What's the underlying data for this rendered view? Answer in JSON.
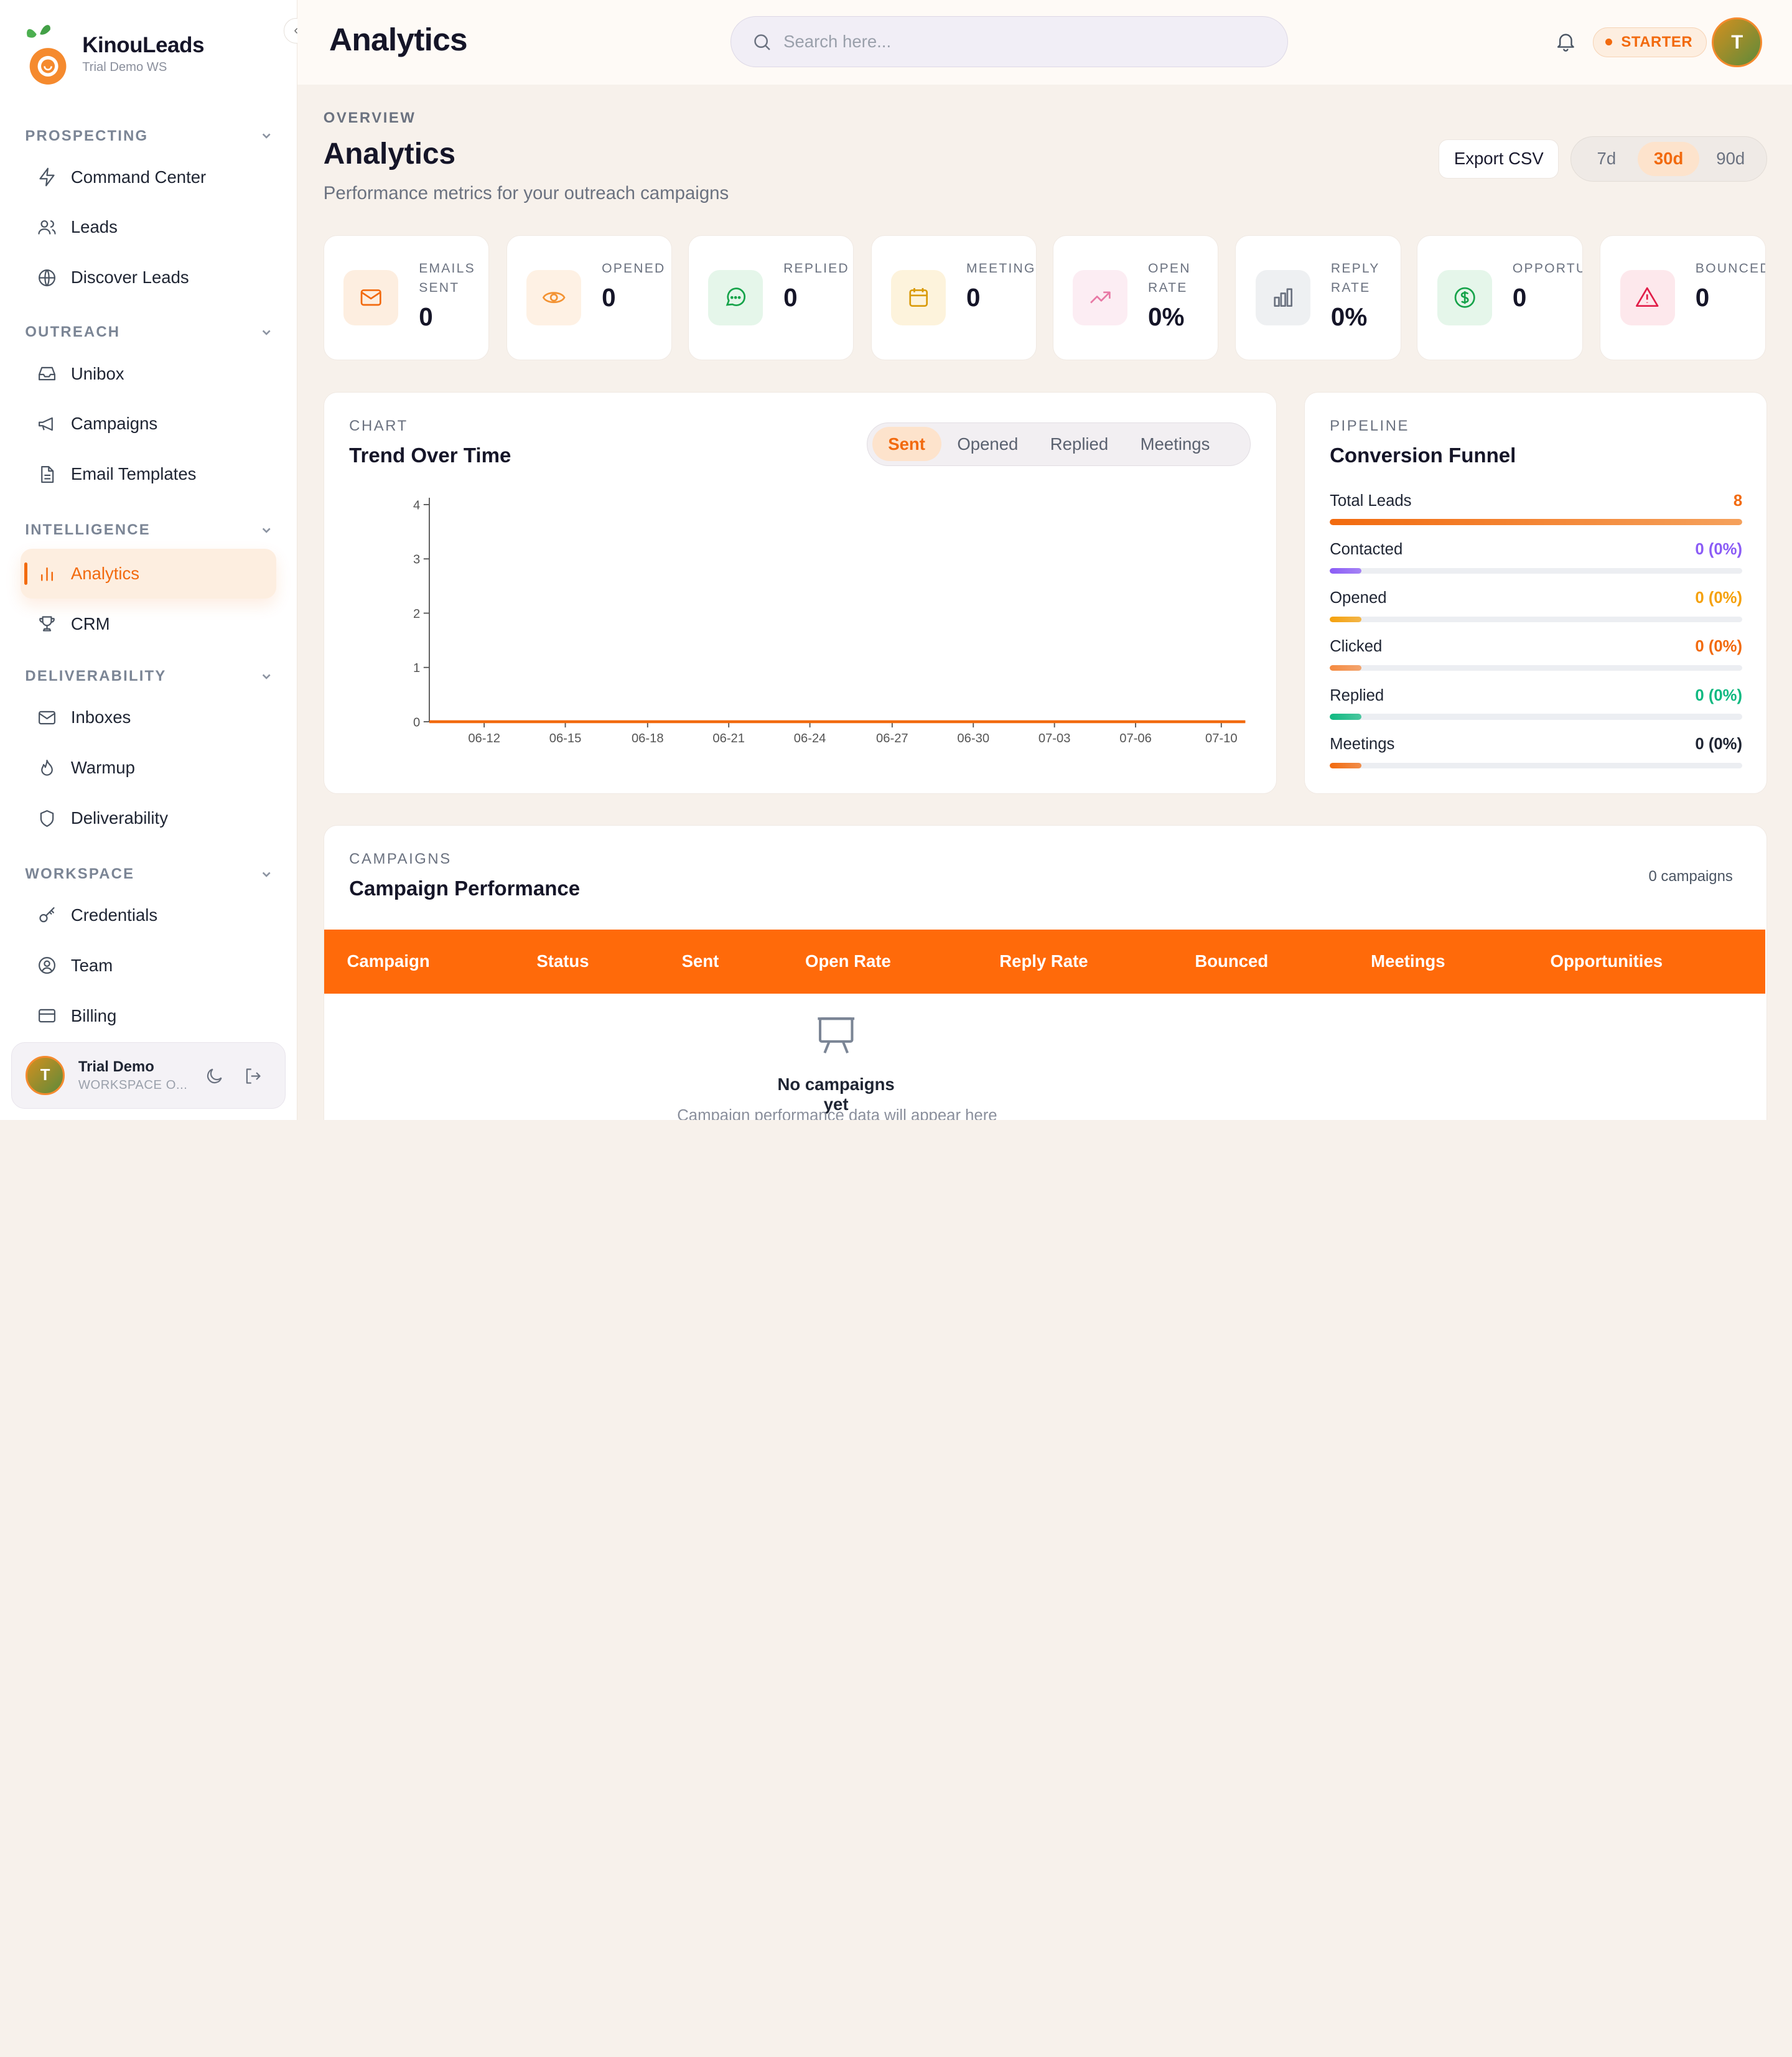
{
  "brand": {
    "name": "KinouLeads",
    "workspace": "Trial Demo WS"
  },
  "topbar": {
    "title": "Analytics",
    "search_placeholder": "Search here...",
    "plan": "STARTER",
    "avatar_initial": "T"
  },
  "sidebar": {
    "sections": [
      {
        "title": "PROSPECTING",
        "items": [
          {
            "label": "Command Center",
            "icon": "zap-icon"
          },
          {
            "label": "Leads",
            "icon": "users-icon"
          },
          {
            "label": "Discover Leads",
            "icon": "globe-icon"
          }
        ]
      },
      {
        "title": "OUTREACH",
        "items": [
          {
            "label": "Unibox",
            "icon": "inbox-icon"
          },
          {
            "label": "Campaigns",
            "icon": "megaphone-icon"
          },
          {
            "label": "Email Templates",
            "icon": "file-text-icon"
          }
        ]
      },
      {
        "title": "INTELLIGENCE",
        "items": [
          {
            "label": "Analytics",
            "icon": "bar-chart-icon",
            "active": true
          },
          {
            "label": "CRM",
            "icon": "trophy-icon"
          }
        ]
      },
      {
        "title": "DELIVERABILITY",
        "items": [
          {
            "label": "Inboxes",
            "icon": "mail-icon"
          },
          {
            "label": "Warmup",
            "icon": "flame-icon"
          },
          {
            "label": "Deliverability",
            "icon": "shield-icon"
          }
        ]
      },
      {
        "title": "WORKSPACE",
        "items": [
          {
            "label": "Credentials",
            "icon": "key-icon"
          },
          {
            "label": "Team",
            "icon": "user-circle-icon"
          },
          {
            "label": "Billing",
            "icon": "credit-card-icon"
          }
        ]
      }
    ],
    "user": {
      "name": "Trial Demo",
      "workspace": "WORKSPACE O...",
      "initial": "T"
    }
  },
  "header": {
    "overline": "OVERVIEW",
    "title": "Analytics",
    "subtitle": "Performance metrics for your outreach campaigns",
    "export_label": "Export CSV",
    "ranges": [
      "7d",
      "30d",
      "90d"
    ],
    "active_range": "30d"
  },
  "stats": [
    {
      "label": "EMAILS\nSENT",
      "value": "0",
      "icon": "mail-icon",
      "color": "#f26a0e",
      "bg": "#fdeee0"
    },
    {
      "label": "OPENED",
      "value": "0",
      "icon": "eye-icon",
      "color": "#f39333",
      "bg": "#fef1e4"
    },
    {
      "label": "REPLIED",
      "value": "0",
      "icon": "message-icon",
      "color": "#16a34a",
      "bg": "#e5f6ea"
    },
    {
      "label": "MEETINGS",
      "value": "0",
      "icon": "calendar-icon",
      "color": "#d99a0a",
      "bg": "#fdf3dc"
    },
    {
      "label": "OPEN\nRATE",
      "value": "0%",
      "icon": "trending-up-icon",
      "color": "#e879a5",
      "bg": "#fcedf3"
    },
    {
      "label": "REPLY\nRATE",
      "value": "0%",
      "icon": "bar-chart-icon",
      "color": "#6b7280",
      "bg": "#eef0f2"
    },
    {
      "label": "OPPORTUNITIES",
      "value": "0",
      "icon": "dollar-icon",
      "color": "#16a34a",
      "bg": "#e5f6ea"
    },
    {
      "label": "BOUNCED",
      "value": "0",
      "icon": "alert-triangle-icon",
      "color": "#e11d48",
      "bg": "#fde8ec"
    }
  ],
  "trend": {
    "kicker": "CHART",
    "title": "Trend Over Time",
    "tabs": [
      "Sent",
      "Opened",
      "Replied",
      "Meetings"
    ],
    "active_tab": "Sent"
  },
  "chart_data": {
    "type": "line",
    "title": "",
    "xlabel": "",
    "ylabel": "",
    "x_ticks": [
      "06-12",
      "06-15",
      "06-18",
      "06-21",
      "06-24",
      "06-27",
      "06-30",
      "07-03",
      "07-06",
      "07-10"
    ],
    "y_ticks": [
      0,
      1,
      2,
      3,
      4
    ],
    "ylim": [
      0,
      4
    ],
    "series": [
      {
        "values": [
          0,
          0,
          0,
          0,
          0,
          0,
          0,
          0,
          0,
          0
        ],
        "color": "#f26a0e"
      }
    ]
  },
  "funnel": {
    "kicker": "PIPELINE",
    "title": "Conversion Funnel",
    "rows": [
      {
        "label": "Total Leads",
        "value": "8",
        "fraction": 1.0,
        "color": "#f26a0e",
        "value_color": "#f26a0e"
      },
      {
        "label": "Contacted",
        "value": "0 (0%)",
        "fraction": 0.0,
        "color": "#8b5cf6",
        "value_color": "#8b5cf6"
      },
      {
        "label": "Opened",
        "value": "0 (0%)",
        "fraction": 0.0,
        "color": "#f5a10c",
        "value_color": "#f5a10c"
      },
      {
        "label": "Clicked",
        "value": "0 (0%)",
        "fraction": 0.0,
        "color": "#f58a40",
        "value_color": "#f26a0e"
      },
      {
        "label": "Replied",
        "value": "0 (0%)",
        "fraction": 0.0,
        "color": "#10b981",
        "value_color": "#10b981"
      },
      {
        "label": "Meetings",
        "value": "0 (0%)",
        "fraction": 0.0,
        "color": "#f26a0e",
        "value_color": "#1f2533"
      }
    ]
  },
  "campaigns": {
    "kicker": "CAMPAIGNS",
    "title": "Campaign Performance",
    "count": "0 campaigns",
    "columns": [
      "Campaign",
      "Status",
      "Sent",
      "Open Rate",
      "Reply Rate",
      "Bounced",
      "Meetings",
      "Opportunities"
    ],
    "empty_title": "No campaigns yet",
    "empty_sub": "Campaign performance data will appear here"
  }
}
